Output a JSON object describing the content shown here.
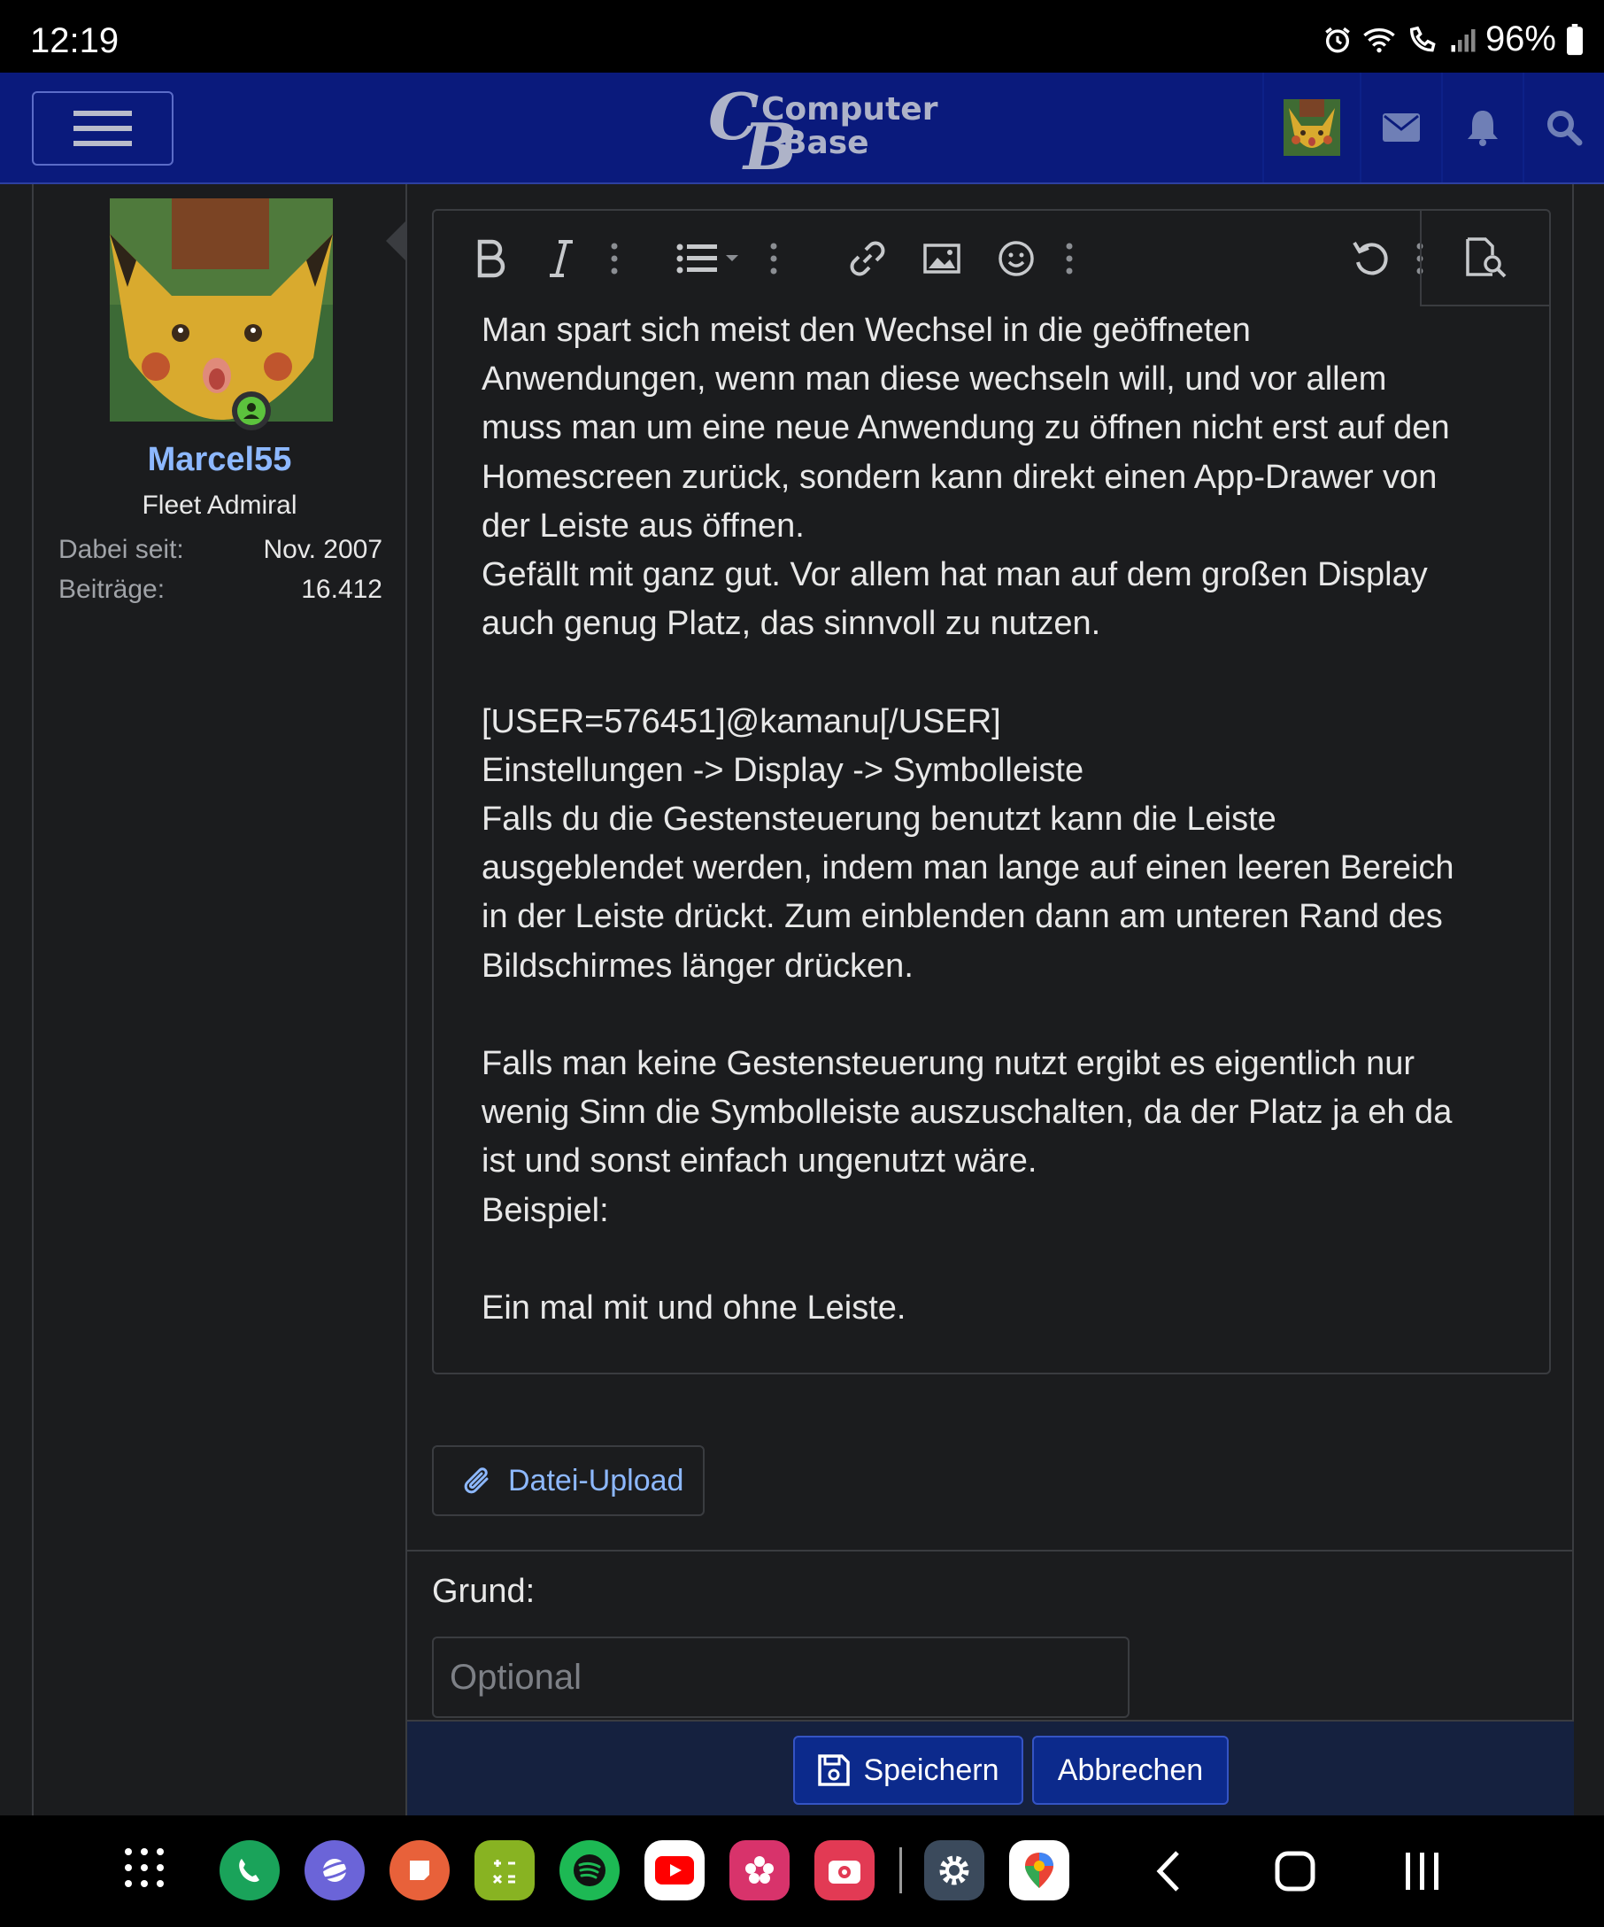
{
  "status_bar": {
    "time": "12:19",
    "battery": "96%"
  },
  "header": {
    "logo_line1": "Computer",
    "logo_line2": "Base",
    "logo_c": "C",
    "logo_b": "B"
  },
  "user": {
    "name": "Marcel55",
    "title": "Fleet Admiral",
    "joined_label": "Dabei seit:",
    "joined_value": "Nov. 2007",
    "posts_label": "Beiträge:",
    "posts_value": "16.412"
  },
  "editor": {
    "content": "Man spart sich meist den Wechsel in die geöffneten\nAnwendungen, wenn man diese wechseln will, und vor allem\nmuss man um eine neue Anwendung zu öffnen nicht erst auf den\nHomescreen zurück, sondern kann direkt einen App-Drawer von\nder Leiste aus öffnen.\nGefällt mit ganz gut. Vor allem hat man auf dem großen Display\nauch genug Platz, das sinnvoll zu nutzen.\n\n[USER=576451]@kamanu[/USER]\nEinstellungen -> Display -> Symbolleiste\nFalls du die Gestensteuerung benutzt kann die Leiste\nausgeblendet werden, indem man lange auf einen leeren Bereich\nin der Leiste drückt. Zum einblenden dann am unteren Rand des\nBildschirmes länger drücken.\n\nFalls man keine Gestensteuerung nutzt ergibt es eigentlich nur\nwenig Sinn die Symbolleiste auszuschalten, da der Platz ja eh da\nist und sonst einfach ungenutzt wäre.\nBeispiel:\n\nEin mal mit und ohne Leiste."
  },
  "form": {
    "upload_label": "Datei-Upload",
    "reason_label": "Grund:",
    "reason_placeholder": "Optional",
    "reason_value": "",
    "save_label": "Speichern",
    "cancel_label": "Abbrechen"
  },
  "colors": {
    "header_bg": "#0a1a7c",
    "page_bg": "#1b1c1e",
    "accent_link": "#8db8ff",
    "button_bg": "#0c2a8c"
  }
}
